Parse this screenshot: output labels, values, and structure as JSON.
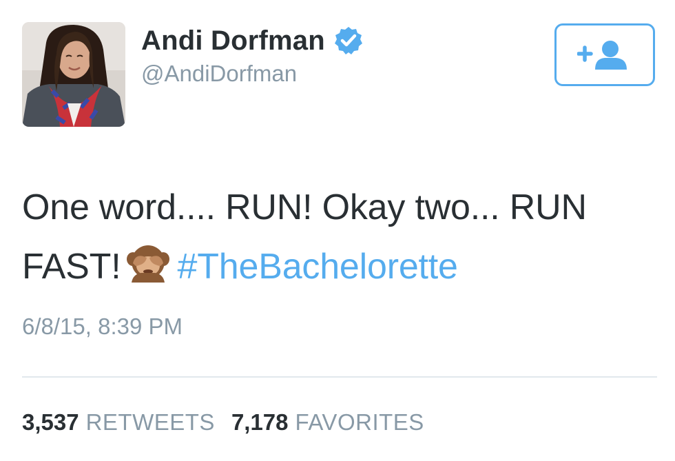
{
  "author": {
    "name": "Andi Dorfman",
    "handle": "@AndiDorfman",
    "verified_icon": "verified-badge-icon",
    "avatar_icon": "profile-photo"
  },
  "follow_button": {
    "icon": "add-user-icon",
    "color": "#55acee"
  },
  "tweet": {
    "text_part1": "One word.... RUN! Okay two... RUN FAST!",
    "emoji": "see-no-evil-monkey-emoji",
    "hashtag": "#TheBachelorette",
    "timestamp": "6/8/15, 8:39 PM"
  },
  "stats": {
    "retweets_count": "3,537",
    "retweets_label": "RETWEETS",
    "favorites_count": "7,178",
    "favorites_label": "FAVORITES"
  },
  "colors": {
    "text": "#292f33",
    "muted": "#8899a6",
    "accent": "#55acee",
    "divider": "#e1e8ed"
  }
}
